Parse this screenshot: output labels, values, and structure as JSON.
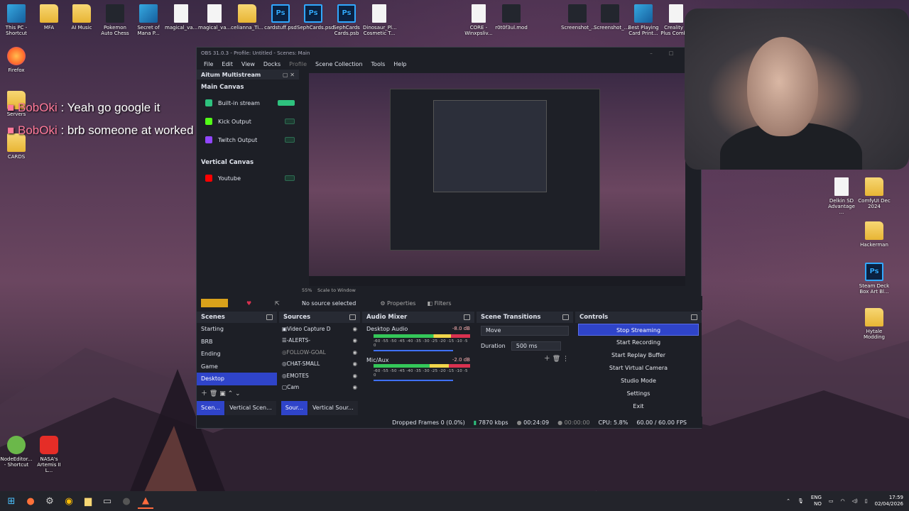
{
  "desktop_icons": [
    {
      "label": "This PC - Shortcut",
      "icon": "this-pc-icon"
    },
    {
      "label": "MFA",
      "icon": "folder-icon"
    },
    {
      "label": "AI Music",
      "icon": "folder-icon"
    },
    {
      "label": "Pokemon Auto Chess",
      "icon": "app-icon"
    },
    {
      "label": "Secret of Mana P...",
      "icon": "app-icon"
    },
    {
      "label": "magical_va...",
      "icon": "file-icon"
    },
    {
      "label": "magical_va...",
      "icon": "file-icon"
    },
    {
      "label": "celianna_Ti...",
      "icon": "folder-icon"
    },
    {
      "label": "cardstuff.psd",
      "icon": "ps-icon"
    },
    {
      "label": "SephCards.psd",
      "icon": "ps-icon"
    },
    {
      "label": "SephCards Cards.psb",
      "icon": "ps-icon"
    },
    {
      "label": "Dinosaur_Pl... Cosmetic T...",
      "icon": "file-icon"
    },
    {
      "label": "CORE - Winxpsliv...",
      "icon": "file-icon"
    },
    {
      "label": "r0t0f3ul.mod",
      "icon": "file-icon"
    },
    {
      "label": "Screenshot_...",
      "icon": "image-icon"
    },
    {
      "label": "Screenshot_...",
      "icon": "image-icon"
    },
    {
      "label": "Best Playing Card Print...",
      "icon": "app-icon"
    },
    {
      "label": "Creality K Plus Comb...",
      "icon": "app-icon"
    },
    {
      "label": "Firefox",
      "icon": "firefox-icon"
    },
    {
      "label": "Servers",
      "icon": "folder-icon"
    },
    {
      "label": "CARDS",
      "icon": "folder-icon"
    },
    {
      "label": "Delkin SD Advantage ...",
      "icon": "app-icon"
    },
    {
      "label": "ComfyUI Dec 2024",
      "icon": "folder-icon"
    },
    {
      "label": "Hackerman",
      "icon": "folder-icon"
    },
    {
      "label": "Steam Deck Box Art Bl...",
      "icon": "ps-icon"
    },
    {
      "label": "Hytale Modding",
      "icon": "folder-icon"
    },
    {
      "label": "NodeEditor... - Shortcut",
      "icon": "app-icon"
    },
    {
      "label": "NASA's Artemis II L...",
      "icon": "youtube-icon"
    }
  ],
  "chat": [
    {
      "user": "BobOki",
      "sep": " : ",
      "message": "Yeah go google it"
    },
    {
      "user": "BobOki",
      "sep": " : ",
      "message": "brb someone at worked dinged me"
    }
  ],
  "obs": {
    "title": "OBS 31.0.3 - Profile: Untitled - Scenes: Main",
    "menu": [
      "File",
      "Edit",
      "View",
      "Docks",
      "Profile",
      "Scene Collection",
      "Tools",
      "Help"
    ],
    "multistream": {
      "title": "Aitum Multistream",
      "main_canvas": "Main Canvas",
      "outputs": [
        {
          "label": "Built-in stream",
          "color": "#2ec27e",
          "on": true
        },
        {
          "label": "Kick Output",
          "color": "#53fc18",
          "on": false
        },
        {
          "label": "Twitch Output",
          "color": "#9146ff",
          "on": false
        }
      ],
      "vertical_canvas": "Vertical Canvas",
      "vertical_outputs": [
        {
          "label": "Youtube",
          "color": "#ff0000",
          "on": false
        }
      ]
    },
    "zoom": "55%",
    "zoom_mode": "Scale to Window",
    "no_source": "No source selected",
    "properties": "Properties",
    "filters": "Filters",
    "scenes": {
      "title": "Scenes",
      "items": [
        "Starting",
        "BRB",
        "Ending",
        "Game",
        "Desktop"
      ],
      "selected": "Desktop"
    },
    "sources": {
      "title": "Sources",
      "items": [
        "Video Capture D",
        "-ALERTS-",
        "FOLLOW-GOAL",
        "CHAT-SMALL",
        "EMOTES",
        "Cam"
      ]
    },
    "mixer": {
      "title": "Audio Mixer",
      "channels": [
        {
          "name": "Desktop Audio",
          "db": "-8.0 dB"
        },
        {
          "name": "Mic/Aux",
          "db": "-2.0 dB"
        }
      ],
      "scale": "-60 -55 -50 -45 -40 -35 -30 -25 -20 -15 -10 -5 0"
    },
    "transitions": {
      "title": "Scene Transitions",
      "selected": "Move",
      "duration_label": "Duration",
      "duration_value": "500 ms"
    },
    "controls": {
      "title": "Controls",
      "buttons": [
        "Stop Streaming",
        "Start Recording",
        "Start Replay Buffer",
        "Start Virtual Camera",
        "Studio Mode",
        "Settings",
        "Exit"
      ]
    },
    "bottom_tabs_left": [
      "Scen...",
      "Vertical Scen..."
    ],
    "bottom_tabs_mid": [
      "Sour...",
      "Vertical Sour..."
    ],
    "status": {
      "dropped": "Dropped Frames 0 (0.0%)",
      "bitrate": "7870 kbps",
      "stream_time": "00:24:09",
      "rec_time": "00:00:00",
      "cpu": "CPU: 5.8%",
      "fps": "60.00 / 60.00 FPS"
    }
  },
  "tray": {
    "lang_top": "ENG",
    "lang_bottom": "NO",
    "time": "17:59",
    "date": "02/04/2026"
  }
}
